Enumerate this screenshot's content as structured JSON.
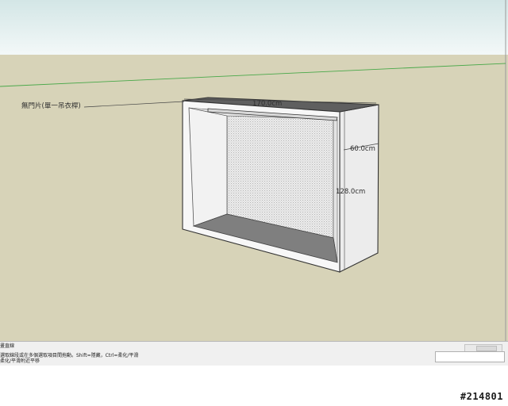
{
  "scene": {
    "callout_label": "無門片(單一吊衣桿)",
    "dim_width": "170.0cm",
    "dim_depth": "60.0cm",
    "dim_height": "128.0cm"
  },
  "status_bar": {
    "tool_name": "畫直線",
    "hint_line1": "選取線段或在多個選取項目間拖動。Shift=隱藏，Ctrl=柔化/平滑",
    "hint_line2": "柔化/平滑附近平移"
  },
  "watermark": "#214801",
  "colors": {
    "sky_top": "#d3e6e6",
    "sky_bottom": "#f3f8f8",
    "ground": "#d7d3b8",
    "horizon_axis": "#49a849",
    "cabinet_edge": "#333333",
    "cabinet_panel": "#f5f5f5",
    "cabinet_interior_floor": "#7f7f7f"
  }
}
